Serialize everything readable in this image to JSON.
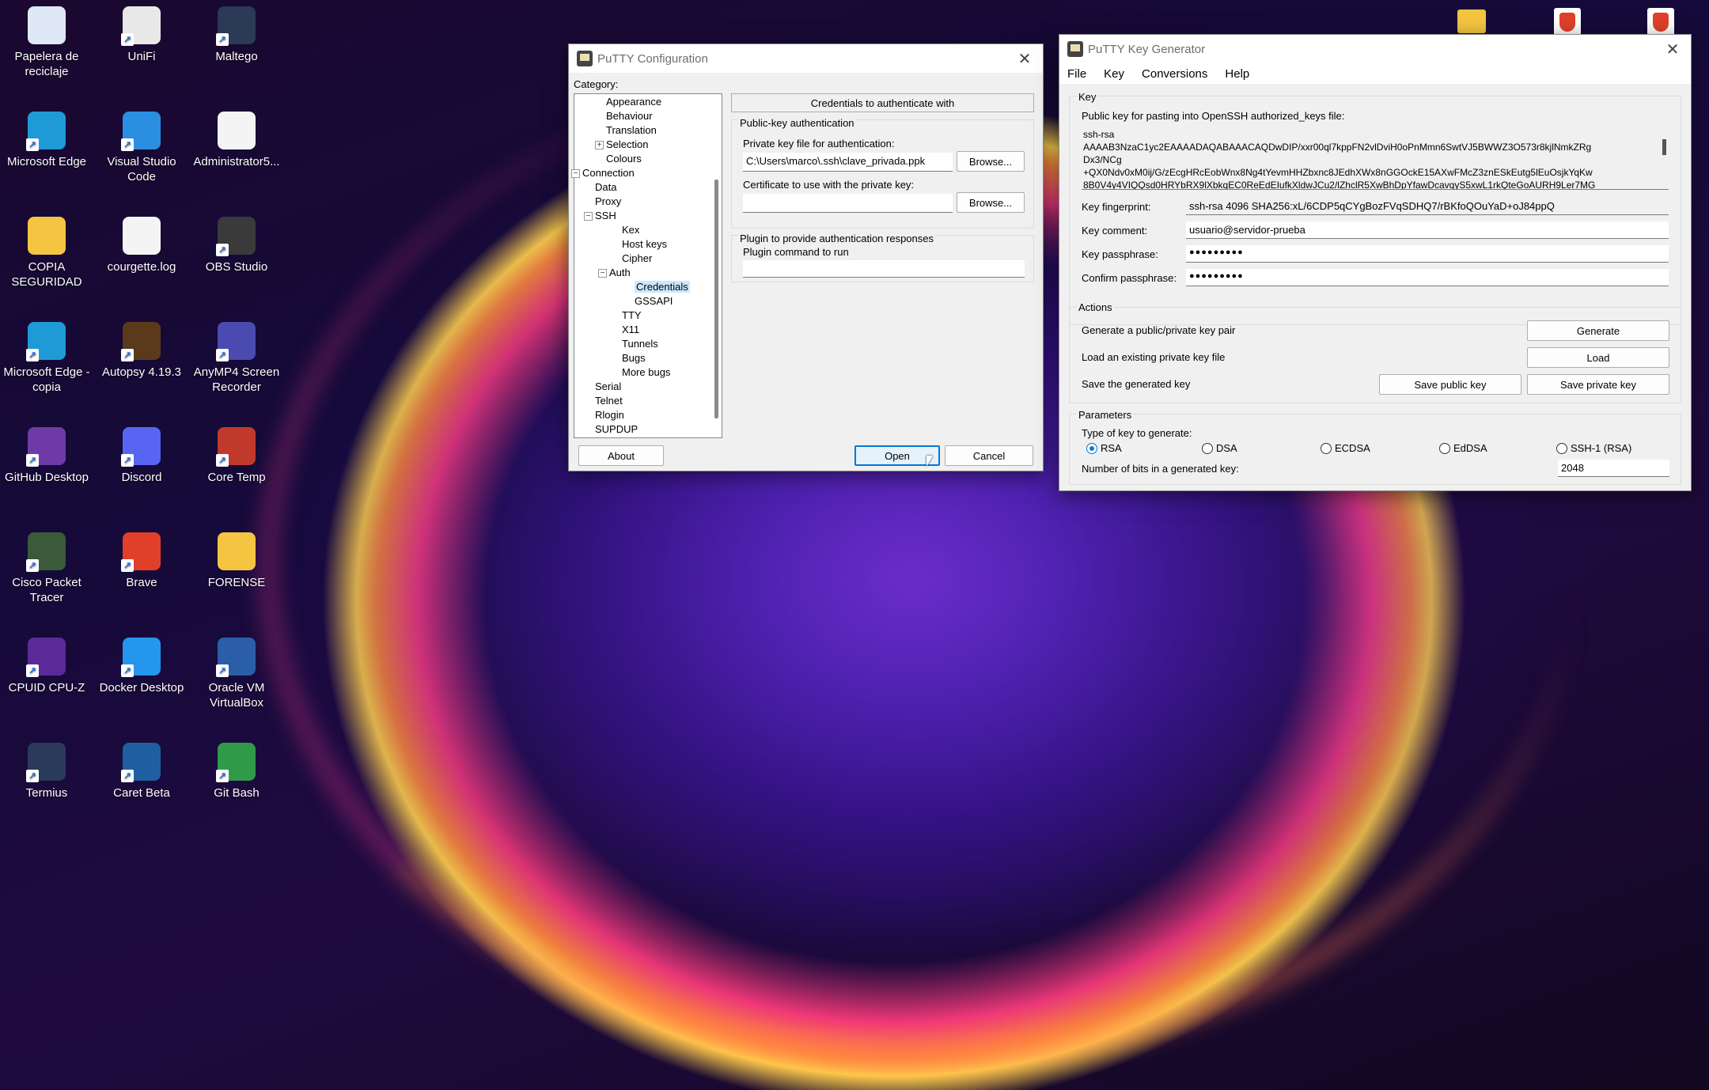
{
  "desktop": {
    "icons": [
      {
        "label": "Papelera de reciclaje",
        "icon": "recycle-bin-icon"
      },
      {
        "label": "UniFi",
        "icon": "unifi-icon"
      },
      {
        "label": "Maltego",
        "icon": "maltego-icon"
      },
      {
        "label": "Microsoft Edge",
        "icon": "edge-icon"
      },
      {
        "label": "Visual Studio Code",
        "icon": "vscode-icon"
      },
      {
        "label": "Administrator5...",
        "icon": "document-icon"
      },
      {
        "label": "COPIA SEGURIDAD",
        "icon": "folder-icon"
      },
      {
        "label": "courgette.log",
        "icon": "document-icon"
      },
      {
        "label": "OBS Studio",
        "icon": "obs-icon"
      },
      {
        "label": "Microsoft Edge - copia",
        "icon": "edge-icon"
      },
      {
        "label": "Autopsy 4.19.3",
        "icon": "autopsy-icon"
      },
      {
        "label": "AnyMP4 Screen Recorder",
        "icon": "anymp4-icon"
      },
      {
        "label": "GitHub Desktop",
        "icon": "github-icon"
      },
      {
        "label": "Discord",
        "icon": "discord-icon"
      },
      {
        "label": "Core Temp",
        "icon": "coretemp-icon"
      },
      {
        "label": "Cisco Packet Tracer",
        "icon": "packet-tracer-icon"
      },
      {
        "label": "Brave",
        "icon": "brave-icon"
      },
      {
        "label": "FORENSE",
        "icon": "folder-icon"
      },
      {
        "label": "CPUID CPU-Z",
        "icon": "cpuz-icon"
      },
      {
        "label": "Docker Desktop",
        "icon": "docker-icon"
      },
      {
        "label": "Oracle VM VirtualBox",
        "icon": "virtualbox-icon"
      },
      {
        "label": "Termius",
        "icon": "termius-icon"
      },
      {
        "label": "Caret Beta",
        "icon": "caret-icon"
      },
      {
        "label": "Git Bash",
        "icon": "gitbash-icon"
      }
    ]
  },
  "putty_config": {
    "title": "PuTTY Configuration",
    "category_label": "Category:",
    "tree": [
      {
        "label": "Appearance"
      },
      {
        "label": "Behaviour"
      },
      {
        "label": "Translation"
      },
      {
        "label": "Selection",
        "expander": "+"
      },
      {
        "label": "Colours"
      },
      {
        "label": "Connection",
        "expander": "−"
      },
      {
        "label": "Data"
      },
      {
        "label": "Proxy"
      },
      {
        "label": "SSH",
        "expander": "−"
      },
      {
        "label": "Kex"
      },
      {
        "label": "Host keys"
      },
      {
        "label": "Cipher"
      },
      {
        "label": "Auth",
        "expander": "−"
      },
      {
        "label": "Credentials",
        "selected": true
      },
      {
        "label": "GSSAPI"
      },
      {
        "label": "TTY"
      },
      {
        "label": "X11"
      },
      {
        "label": "Tunnels"
      },
      {
        "label": "Bugs"
      },
      {
        "label": "More bugs"
      },
      {
        "label": "Serial"
      },
      {
        "label": "Telnet"
      },
      {
        "label": "Rlogin"
      },
      {
        "label": "SUPDUP"
      }
    ],
    "panel_header": "Credentials to authenticate with",
    "pubkey_group": "Public-key authentication",
    "private_key_label": "Private key file for authentication:",
    "private_key_value": "C:\\Users\\marco\\.ssh\\clave_privada.ppk",
    "certificate_label": "Certificate to use with the private key:",
    "certificate_value": "",
    "browse_label": "Browse...",
    "plugin_group": "Plugin to provide authentication responses",
    "plugin_label": "Plugin command to run",
    "plugin_value": "",
    "about_label": "About",
    "open_label": "Open",
    "cancel_label": "Cancel"
  },
  "puttygen": {
    "title": "PuTTY Key Generator",
    "menu": [
      "File",
      "Key",
      "Conversions",
      "Help"
    ],
    "key_group": "Key",
    "pubkey_label": "Public key for pasting into OpenSSH authorized_keys file:",
    "pubkey_lines": [
      "ssh-rsa",
      "AAAAB3NzaC1yc2EAAAADAQABAAACAQDwDIP/xxr00ql7kppFN2vlDviH0oPnMmn6SwtVJ5BWWZ3O573r8kjlNmkZRg",
      "Dx3/NCg",
      "+QX0Ndv0xM0ij/G/zEcgHRcEobWnx8Ng4tYevmHHZbxnc8JEdhXWx8nGGOckE15AXwFMcZ3znESkEutg5lEuOsjkYqKw",
      "8B0V4y4VIQQsd0HRYbRX9lXbkqEC0ReEdEIufkXldwJCu2/lZhclR5XwBhDpYfawDcavqyS5xwL1rkQteGoAURH9Ler7MG"
    ],
    "fingerprint_label": "Key fingerprint:",
    "fingerprint_value": "ssh-rsa 4096 SHA256:xL/6CDP5qCYgBozFVqSDHQ7/rBKfoQOuYaD+oJ84ppQ",
    "comment_label": "Key comment:",
    "comment_value": "usuario@servidor-prueba",
    "passphrase_label": "Key passphrase:",
    "passphrase_value": "●●●●●●●●●",
    "confirm_label": "Confirm passphrase:",
    "confirm_value": "●●●●●●●●●",
    "actions_group": "Actions",
    "generate_text": "Generate a public/private key pair",
    "generate_label": "Generate",
    "load_text": "Load an existing private key file",
    "load_label": "Load",
    "save_text": "Save the generated key",
    "save_public_label": "Save public key",
    "save_private_label": "Save private key",
    "params_group": "Parameters",
    "type_label": "Type of key to generate:",
    "key_types": [
      "RSA",
      "DSA",
      "ECDSA",
      "EdDSA",
      "SSH-1 (RSA)"
    ],
    "selected_type": "RSA",
    "bits_label": "Number of bits in a generated key:",
    "bits_value": "2048"
  }
}
